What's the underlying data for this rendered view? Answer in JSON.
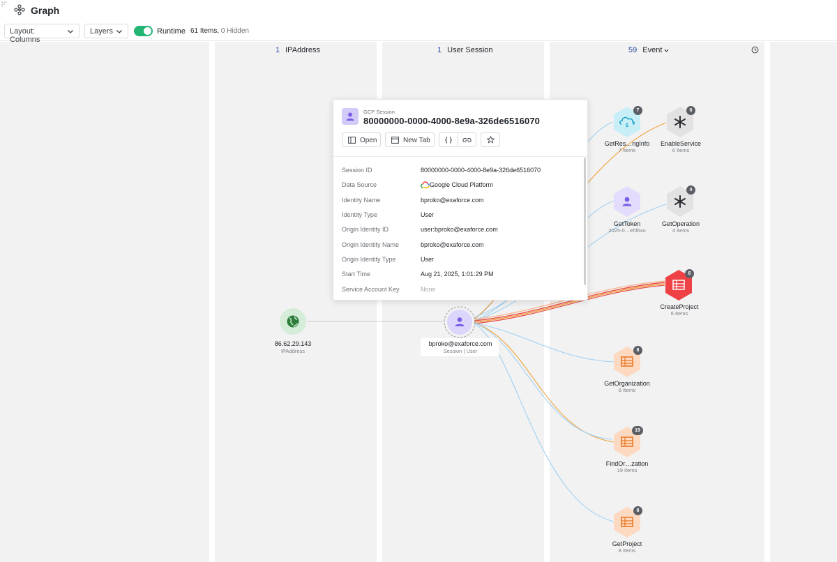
{
  "header": {
    "title": "Graph",
    "app_icon": "graph-icon"
  },
  "toolbar": {
    "layout_label": "Layout: Columns",
    "layers_label": "Layers",
    "runtime_label": "Runtime",
    "runtime_enabled": true,
    "items_count": "61 Items,",
    "hidden_count": "0 Hidden"
  },
  "columns": [
    {
      "count": "1",
      "label": "IPAddress"
    },
    {
      "count": "1",
      "label": "User Session"
    },
    {
      "count": "59",
      "label": "Event",
      "has_dropdown": true,
      "history_icon": "clock-icon"
    }
  ],
  "nodes": {
    "ip": {
      "label": "86.62.29.143",
      "sub": "IPAddress",
      "icon": "globe-icon"
    },
    "session": {
      "label": "bproko@exaforce.com",
      "sub": "Session | User",
      "icon": "user-icon"
    },
    "events": [
      {
        "label": "GetRes…ngInfo",
        "sub": "7 Items",
        "badge": "7",
        "icon": "cloud-billing-icon"
      },
      {
        "label": "EnableService",
        "sub": "6 Items",
        "badge": "6",
        "icon": "asterisk-icon"
      },
      {
        "label": "GetToken",
        "sub": "2025-0…ehf6xo",
        "badge": "",
        "icon": "user-icon"
      },
      {
        "label": "GetOperation",
        "sub": "4 Items",
        "badge": "4",
        "icon": "asterisk-icon"
      },
      {
        "label": "CreateProject",
        "sub": "6 Items",
        "badge": "6",
        "icon": "project-icon"
      },
      {
        "label": "GetOrganization",
        "sub": "8 Items",
        "badge": "8",
        "icon": "project-icon"
      },
      {
        "label": "FindOr…zation",
        "sub": "19 Items",
        "badge": "19",
        "icon": "project-icon"
      },
      {
        "label": "GetProject",
        "sub": "8 Items",
        "badge": "8",
        "icon": "project-icon"
      }
    ]
  },
  "popup": {
    "type": "GCP Session",
    "title": "80000000-0000-4000-8e9a-326de6516070",
    "buttons": {
      "open": "Open",
      "new_tab": "New Tab"
    },
    "fields": [
      {
        "key": "Session ID",
        "value": "80000000-0000-4000-8e9a-326de6516070"
      },
      {
        "key": "Data Source",
        "value": "Google Cloud Platform"
      },
      {
        "key": "Identity Name",
        "value": "bproko@exaforce.com"
      },
      {
        "key": "Identity Type",
        "value": "User"
      },
      {
        "key": "Origin Identity ID",
        "value": "user:bproko@exaforce.com"
      },
      {
        "key": "Origin Identity Name",
        "value": "bproko@exaforce.com"
      },
      {
        "key": "Origin Identity Type",
        "value": "User"
      },
      {
        "key": "Start Time",
        "value": "Aug 21, 2025, 1:01:29 PM"
      },
      {
        "key": "Service Account Key",
        "value": "None"
      }
    ]
  },
  "colors": {
    "edge_blue": "#9fd0f2",
    "edge_orange": "#f0a33a",
    "edge_red": "#ea4b4b",
    "toggle_on": "#22b573",
    "session_purple": "#ded7fb",
    "create_red": "#ef4247",
    "event_orange": "#fdd9c2"
  }
}
